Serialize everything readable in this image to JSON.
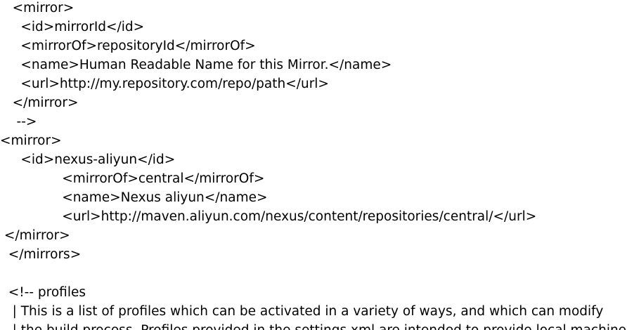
{
  "lines": [
    "   <mirror>",
    "     <id>mirrorId</id>",
    "     <mirrorOf>repositoryId</mirrorOf>",
    "     <name>Human Readable Name for this Mirror.</name>",
    "     <url>http://my.repository.com/repo/path</url>",
    "   </mirror>",
    "    -->",
    "<mirror>",
    "     <id>nexus-aliyun</id>",
    "               <mirrorOf>central</mirrorOf>",
    "               <name>Nexus aliyun</name>",
    "               <url>http://maven.aliyun.com/nexus/content/repositories/central/</url>",
    " </mirror>",
    "  </mirrors>",
    "",
    "  <!-- profiles",
    "   | This is a list of profiles which can be activated in a variety of ways, and which can modify",
    "   | the build process. Profiles provided in the settings.xml are intended to provide local machine-"
  ]
}
